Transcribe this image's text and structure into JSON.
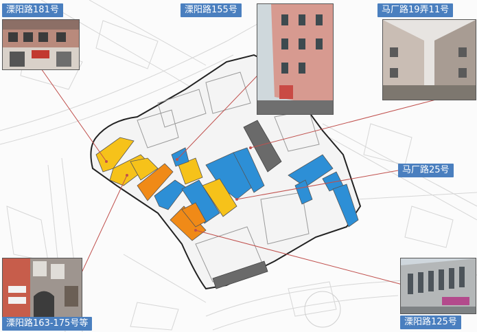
{
  "labels": {
    "l181": "溧阳路181号",
    "l155": "溧阳路155号",
    "ma19": "马厂路19弄11号",
    "ma25": "马厂路25号",
    "l163": "溧阳路163-175号等",
    "l125": "溧阳路125号"
  },
  "colors": {
    "yellow": "#f6c21a",
    "orange": "#f08a17",
    "blue": "#2d8fd6",
    "dark": "#6a6a6a",
    "leader": "#c0504d",
    "label_bg": "#4a7fbf"
  }
}
